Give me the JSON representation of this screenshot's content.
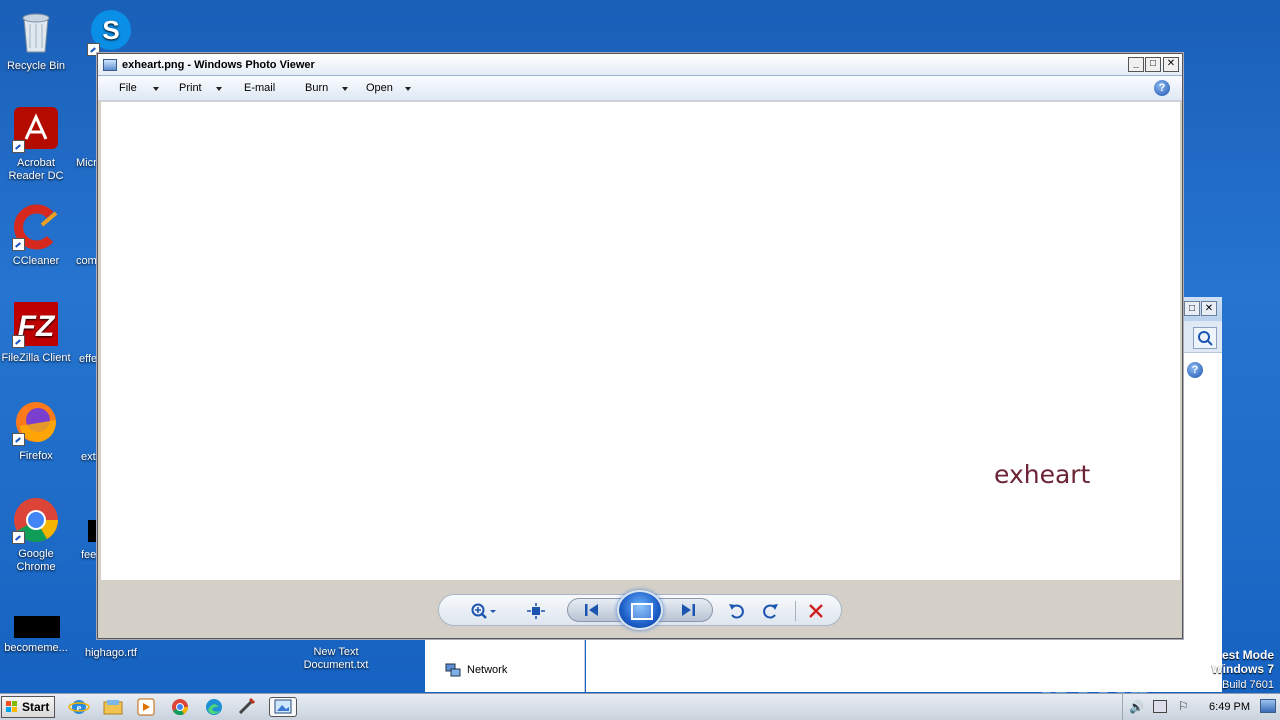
{
  "desktop": {
    "icons": [
      {
        "label": "Recycle Bin"
      },
      {
        "label": "Acrobat Reader DC"
      },
      {
        "label": "CCleaner"
      },
      {
        "label": "FileZilla Client"
      },
      {
        "label": "Firefox"
      },
      {
        "label": "Google Chrome"
      },
      {
        "label": "becomeme..."
      }
    ],
    "partial_labels": [
      "Micr",
      "com",
      "effe",
      "ext",
      "fee",
      "highago.rtf"
    ],
    "new_text_doc": "New Text Document.txt"
  },
  "photo_viewer": {
    "title": "exheart.png - Windows Photo Viewer",
    "menu": [
      {
        "label": "File"
      },
      {
        "label": "Print"
      },
      {
        "label": "E-mail"
      },
      {
        "label": "Burn"
      },
      {
        "label": "Open"
      }
    ],
    "help_glyph": "?",
    "image_text": "exheart",
    "image_text_color": "#6b2435"
  },
  "background_window": {
    "nav_item": "Network"
  },
  "watermark": {
    "text": "ANY ▷ RUN",
    "test_mode_line1": "est Mode",
    "test_mode_line2": "Windows 7",
    "test_mode_line3": "Build 7601"
  },
  "taskbar": {
    "start_label": "Start",
    "clock": "6:49 PM"
  }
}
